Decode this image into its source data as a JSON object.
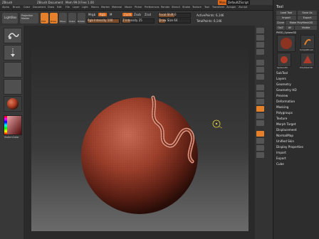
{
  "titlebar": {
    "app": "ZBrush",
    "doc": "ZBrush Document",
    "mem": "Mem 99.0 Free 1.00",
    "menus_btn": "Menus",
    "script_btn": "DefaultZScript"
  },
  "menubar": {
    "items": [
      "Alpha",
      "Brush",
      "Color",
      "Document",
      "Draw",
      "Edit",
      "File",
      "Layer",
      "Light",
      "Macro",
      "Marker",
      "Material",
      "Movie",
      "Picker",
      "Preferences",
      "Render",
      "Stencil",
      "Stroke",
      "Texture",
      "Tool",
      "Transform",
      "Zplugin",
      "Zscript"
    ]
  },
  "shelf": {
    "lightbox": "LightBox",
    "projection_master": "Projection Master",
    "tools": [
      "Edit",
      "Draw",
      "Move",
      "Scale",
      "Rotate"
    ],
    "mrgb": "Mrgb",
    "rgb": "Rgb",
    "m": "M",
    "zadd": "Zadd",
    "zsub": "Zsub",
    "zcut": "Zcut",
    "rgb_intensity": "Rgb Intensity 100",
    "z_intensity": "Z Intensity 25",
    "focal_shift": "Focal Shift 0",
    "draw_size": "Draw Size 64",
    "active_points": "ActivePoints: 6,146",
    "total_points": "TotalPoints: 6,146"
  },
  "leftshelf": {
    "swatch_caption": "SwitchColor"
  },
  "canvas": {
    "accent": "#e6802a"
  },
  "palette": {
    "title": "Tool",
    "buttons": [
      "Load Tool",
      "Save As",
      "Import",
      "Export",
      "Clone",
      "Make PolyMesh3D",
      "GoZ",
      "All",
      "Visible"
    ],
    "current_tool": "PM3D_Sphere3D",
    "thumbs": [
      "PM3D_Sphere3D",
      "SimpleBrush",
      "Sphere3D",
      "PolyMesh3D"
    ],
    "sections": [
      "SubTool",
      "Layers",
      "Geometry",
      "Geometry HD",
      "Preview",
      "Deformation",
      "Masking",
      "Polygroups",
      "Texture",
      "Morph Target",
      "Displacement",
      "NormalMap",
      "Unified Skin",
      "Display Properties",
      "Import",
      "Export",
      "Cube"
    ]
  }
}
